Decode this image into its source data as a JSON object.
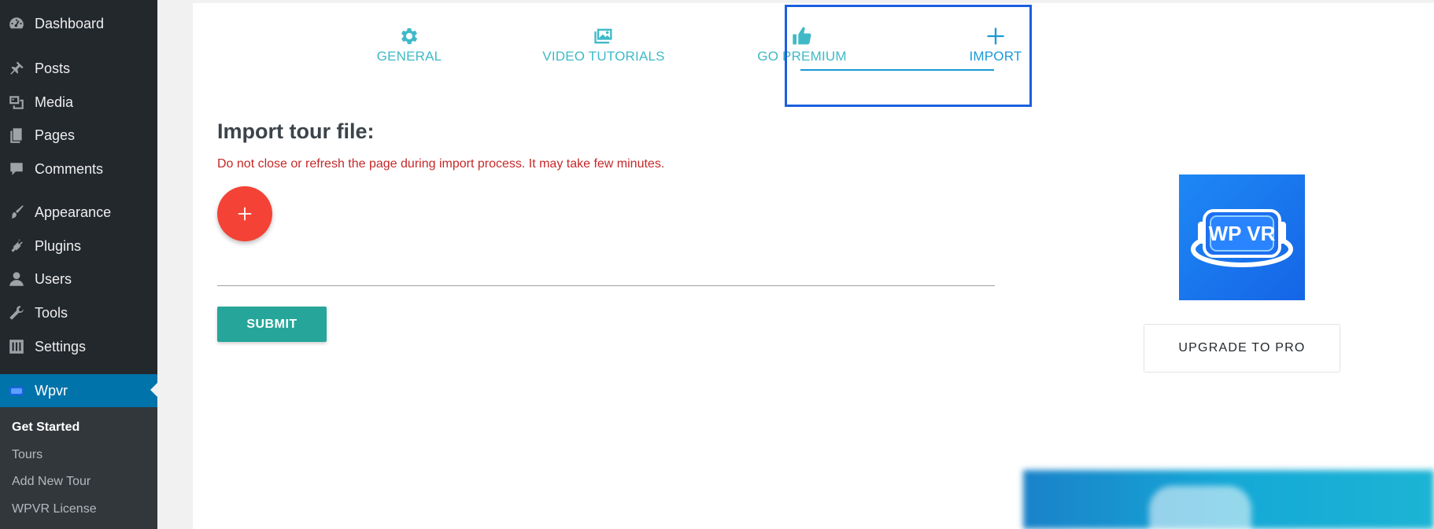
{
  "sidebar": {
    "items": [
      {
        "label": "Dashboard",
        "icon": "dashboard-icon"
      },
      {
        "label": "Posts",
        "icon": "pin-icon"
      },
      {
        "label": "Media",
        "icon": "media-icon"
      },
      {
        "label": "Pages",
        "icon": "pages-icon"
      },
      {
        "label": "Comments",
        "icon": "comment-icon"
      },
      {
        "label": "Appearance",
        "icon": "paintbrush-icon"
      },
      {
        "label": "Plugins",
        "icon": "plugin-icon"
      },
      {
        "label": "Users",
        "icon": "user-icon"
      },
      {
        "label": "Tools",
        "icon": "wrench-icon"
      },
      {
        "label": "Settings",
        "icon": "sliders-icon"
      },
      {
        "label": "Wpvr",
        "icon": "vr-headset-icon"
      }
    ],
    "submenu": [
      {
        "label": "Get Started"
      },
      {
        "label": "Tours"
      },
      {
        "label": "Add New Tour"
      },
      {
        "label": "WPVR License"
      }
    ]
  },
  "tabs": [
    {
      "label": "GENERAL",
      "icon": "gear-icon"
    },
    {
      "label": "VIDEO TUTORIALS",
      "icon": "images-icon"
    },
    {
      "label": "GO PREMIUM",
      "icon": "thumbs-up-icon"
    },
    {
      "label": "IMPORT",
      "icon": "plus-icon"
    }
  ],
  "import": {
    "heading": "Import tour file:",
    "warning": "Do not close or refresh the page during import process. It may take few minutes.",
    "submit_label": "SUBMIT"
  },
  "promo": {
    "logo_text": "WP VR",
    "upgrade_label": "UPGRADE TO PRO"
  },
  "colors": {
    "sidebar_bg": "#23282d",
    "active_menu": "#0073aa",
    "tab_color": "#3fb9c8",
    "tab_selected": "#1a9ad6",
    "warning": "#c62828",
    "fab": "#f44336",
    "submit": "#26a69a",
    "focus_outline": "#1a5fe0"
  }
}
